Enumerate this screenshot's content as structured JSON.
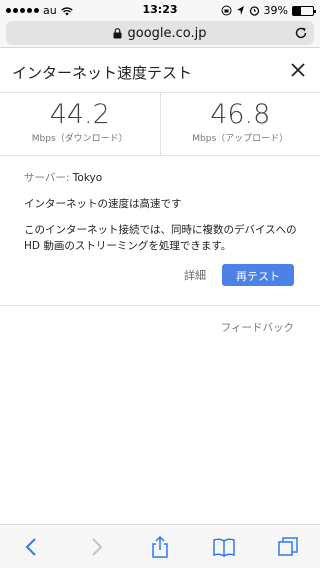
{
  "status_bar": {
    "carrier": "au",
    "time": "13:23",
    "battery_percent": "39%",
    "battery_level": 0.39
  },
  "browser": {
    "url": "google.co.jp"
  },
  "card": {
    "title": "インターネット速度テスト",
    "download": {
      "value": "44.2",
      "label": "Mbps（ダウンロード）"
    },
    "upload": {
      "value": "46.8",
      "label": "Mbps（アップロード）"
    },
    "server_label": "サーバー: ",
    "server_name": "Tokyo",
    "quality_text": "インターネットの速度は高速です",
    "description": "このインターネット接続では、同時に複数のデバイスへの HD 動画のストリーミングを処理できます。",
    "details_label": "詳細",
    "retest_label": "再テスト"
  },
  "feedback_label": "フィードバック",
  "colors": {
    "accent": "#4c82e6",
    "toolbar_icon": "#3478f6",
    "toolbar_icon_disabled": "#c4c4c8"
  },
  "icons": [
    "wifi-icon",
    "lock-icon",
    "reload-icon",
    "location-icon",
    "alarm-icon",
    "close-icon",
    "back-icon",
    "forward-icon",
    "share-icon",
    "bookmarks-icon",
    "tabs-icon"
  ]
}
